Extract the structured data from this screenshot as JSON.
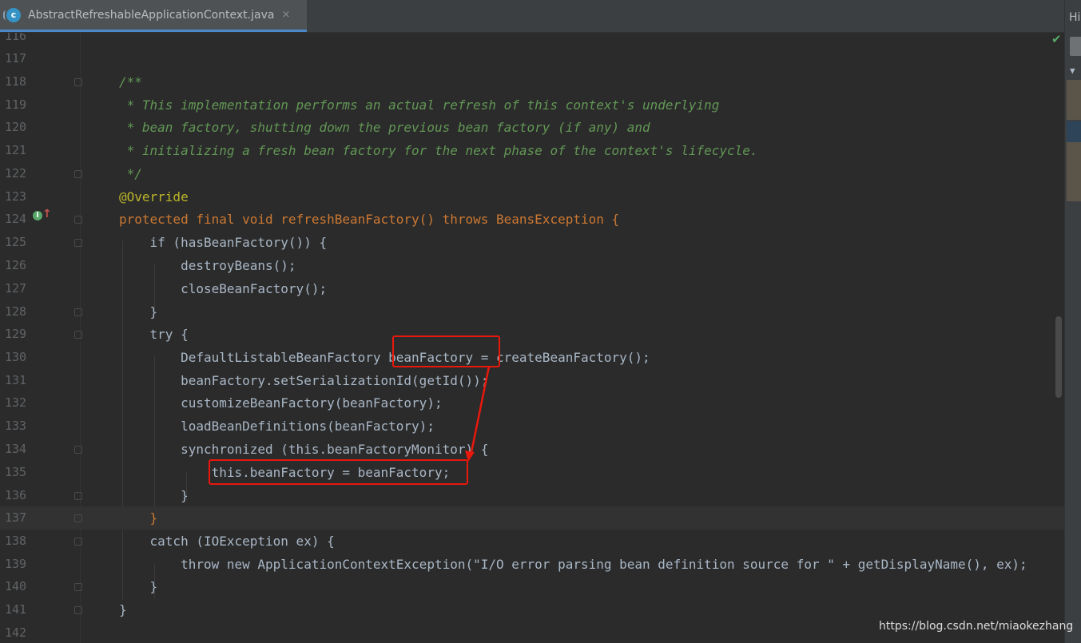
{
  "tab": {
    "title": "AbstractRefreshableApplicationContext.java",
    "close_icon": "×",
    "file_icon_letter": "c"
  },
  "side_panel": {
    "label": "Hi",
    "arrow": "▼"
  },
  "inspection_status": "✔",
  "gutter": {
    "override_icon": "I",
    "override_arrow": "↑"
  },
  "editor": {
    "lines": [
      {
        "num": "116",
        "text": ""
      },
      {
        "num": "117",
        "text": ""
      },
      {
        "num": "118",
        "text": "/**"
      },
      {
        "num": "119",
        "text": " * This implementation performs an actual refresh of this context's underlying"
      },
      {
        "num": "120",
        "text": " * bean factory, shutting down the previous bean factory (if any) and"
      },
      {
        "num": "121",
        "text": " * initializing a fresh bean factory for the next phase of the context's lifecycle."
      },
      {
        "num": "122",
        "text": " */"
      },
      {
        "num": "123",
        "text": "@Override"
      },
      {
        "num": "124",
        "text": "protected final void refreshBeanFactory() throws BeansException {"
      },
      {
        "num": "125",
        "text": "    if (hasBeanFactory()) {"
      },
      {
        "num": "126",
        "text": "        destroyBeans();"
      },
      {
        "num": "127",
        "text": "        closeBeanFactory();"
      },
      {
        "num": "128",
        "text": "    }"
      },
      {
        "num": "129",
        "text": "    try {"
      },
      {
        "num": "130",
        "text": "        DefaultListableBeanFactory beanFactory = createBeanFactory();"
      },
      {
        "num": "131",
        "text": "        beanFactory.setSerializationId(getId());"
      },
      {
        "num": "132",
        "text": "        customizeBeanFactory(beanFactory);"
      },
      {
        "num": "133",
        "text": "        loadBeanDefinitions(beanFactory);"
      },
      {
        "num": "134",
        "text": "        synchronized (this.beanFactoryMonitor) {"
      },
      {
        "num": "135",
        "text": "            this.beanFactory = beanFactory;"
      },
      {
        "num": "136",
        "text": "        }"
      },
      {
        "num": "137",
        "text": "    }"
      },
      {
        "num": "138",
        "text": "    catch (IOException ex) {"
      },
      {
        "num": "139",
        "text": "        throw new ApplicationContextException(\"I/O error parsing bean definition source for \" + getDisplayName(), ex);"
      },
      {
        "num": "140",
        "text": "    }"
      },
      {
        "num": "141",
        "text": "}"
      },
      {
        "num": "142",
        "text": ""
      }
    ]
  },
  "colors": {
    "keyword": "#cc7832",
    "comment": "#629755",
    "annotation": "#bbb529",
    "string": "#6a8759",
    "method": "#6897bb",
    "field": "#9876aa",
    "highlight_box": "#e8180c"
  },
  "watermark": "https://blog.csdn.net/miaokezhang"
}
